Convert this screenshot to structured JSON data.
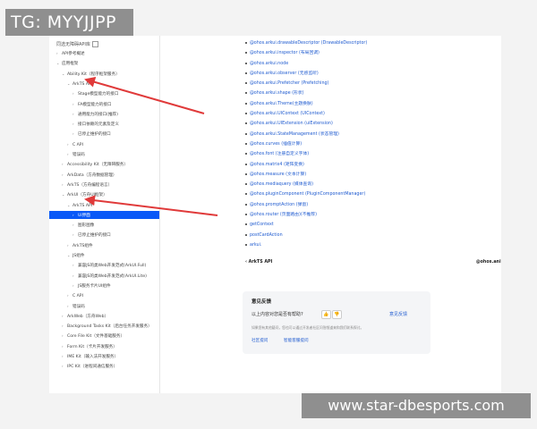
{
  "watermarks": {
    "top": "TG: MYYJJPP",
    "bottom": "www.star-dbesports.com"
  },
  "sidebar": {
    "top_label": "同选无障碍API库",
    "items": [
      {
        "label": "API参考概述",
        "arrow": "›",
        "indent": 0
      },
      {
        "label": "应用框架",
        "arrow": "⌄",
        "indent": 0
      },
      {
        "label": "Ability Kit（程序框架服务）",
        "arrow": "⌄",
        "indent": 1
      },
      {
        "label": "ArkTS API",
        "arrow": "⌄",
        "indent": 2
      },
      {
        "label": "Stage模型能力的接口",
        "arrow": "›",
        "indent": 3
      },
      {
        "label": "FA模型能力的接口",
        "arrow": "›",
        "indent": 3
      },
      {
        "label": "通用能力的接口(推荐)",
        "arrow": "›",
        "indent": 3
      },
      {
        "label": "接口依赖的元素及定义",
        "arrow": "›",
        "indent": 3
      },
      {
        "label": "已停止维护的接口",
        "arrow": "›",
        "indent": 3
      },
      {
        "label": "C API",
        "arrow": "›",
        "indent": 2
      },
      {
        "label": "错误码",
        "arrow": "›",
        "indent": 2
      },
      {
        "label": "Accessibility Kit（无障碍服务）",
        "arrow": "›",
        "indent": 1
      },
      {
        "label": "ArkData（方舟数据管理）",
        "arrow": "›",
        "indent": 1
      },
      {
        "label": "ArkTS（方舟编程语言）",
        "arrow": "›",
        "indent": 1
      },
      {
        "label": "ArkUI（方舟UI框架）",
        "arrow": "⌄",
        "indent": 1
      },
      {
        "label": "ArkTS API",
        "arrow": "⌄",
        "indent": 2
      },
      {
        "label": "UI界面",
        "arrow": "›",
        "indent": 3,
        "active": true
      },
      {
        "label": "图形图像",
        "arrow": "›",
        "indent": 3
      },
      {
        "label": "已停止维护的接口",
        "arrow": "›",
        "indent": 3
      },
      {
        "label": "ArkTS组件",
        "arrow": "›",
        "indent": 2
      },
      {
        "label": "JS组件",
        "arrow": "⌄",
        "indent": 2
      },
      {
        "label": "兼容JS的类Web开发范式(ArkUI.Full)",
        "arrow": "›",
        "indent": 3
      },
      {
        "label": "兼容JS的类Web开发范式(ArkUI.Lite)",
        "arrow": "›",
        "indent": 3
      },
      {
        "label": "JS服务卡片UI组件",
        "arrow": "›",
        "indent": 3
      },
      {
        "label": "C API",
        "arrow": "›",
        "indent": 2
      },
      {
        "label": "错误码",
        "arrow": "›",
        "indent": 2
      },
      {
        "label": "ArkWeb（方舟Web）",
        "arrow": "›",
        "indent": 1
      },
      {
        "label": "Background Tasks Kit（后台任务开发服务）",
        "arrow": "›",
        "indent": 1
      },
      {
        "label": "Core File Kit（文件基础服务）",
        "arrow": "›",
        "indent": 1
      },
      {
        "label": "Form Kit（卡片开发服务）",
        "arrow": "›",
        "indent": 1
      },
      {
        "label": "IME Kit（输入法开发服务）",
        "arrow": "›",
        "indent": 1
      },
      {
        "label": "IPC Kit（进程间通信服务）",
        "arrow": "›",
        "indent": 1
      }
    ]
  },
  "content": {
    "links": [
      "@ohos.arkui.drawableDescriptor (DrawableDescriptor)",
      "@ohos.arkui.inspector (布局回调)",
      "@ohos.arkui.node",
      "@ohos.arkui.observer (无感监听)",
      "@ohos.arkui.Prefetcher (Prefetching)",
      "@ohos.arkui.shape (形状)",
      "@ohos.arkui.Theme(主题换肤)",
      "@ohos.arkui.UIContext (UIContext)",
      "@ohos.arkui.UIExtension (uiExtension)",
      "@ohos.arkui.StateManagement (状态管理)",
      "@ohos.curves (插值计算)",
      "@ohos.font (注册自定义字体)",
      "@ohos.matrix4 (矩阵变换)",
      "@ohos.measure (文本计算)",
      "@ohos.mediaquery (媒体查询)",
      "@ohos.pluginComponent (PluginComponentManager)",
      "@ohos.promptAction (弹窗)",
      "@ohos.router (页面路由)(不推荐)",
      "getContext",
      "postCardAction",
      "arkui."
    ],
    "nav_prev": "ArkTS API",
    "nav_next": "@ohos.anir",
    "feedback": {
      "title": "意见反馈",
      "question": "以上内容对您是否有帮助?",
      "suggest": "意见反馈",
      "note": "如果您有其他疑问，您也可以通过开发者社区问答频道来和我们联系探讨。",
      "link1": "社区提问",
      "link2": "智能客服提问"
    }
  },
  "colors": {
    "accent": "#0a59f7",
    "link": "#1f5bd0",
    "arrow": "#e03a3a"
  }
}
